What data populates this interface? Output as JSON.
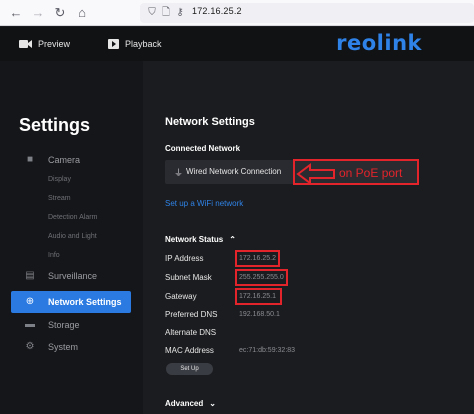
{
  "browser": {
    "url": "172.16.25.2",
    "back_icon": "arrow-left-icon",
    "forward_icon": "arrow-right-icon",
    "reload_icon": "reload-icon",
    "home_icon": "home-icon"
  },
  "header": {
    "preview_label": "Preview",
    "playback_label": "Playback",
    "logo_text": "reolink",
    "logo_color": "#2f83e8"
  },
  "sidebar": {
    "title": "Settings",
    "groups": [
      {
        "label": "Camera",
        "icon": "camera-icon"
      },
      {
        "label": "Surveillance",
        "icon": "surveillance-icon"
      },
      {
        "label": "Network Settings",
        "icon": "globe-icon",
        "active": true
      },
      {
        "label": "Storage",
        "icon": "storage-icon"
      },
      {
        "label": "System",
        "icon": "gear-icon"
      }
    ],
    "camera_subitems": [
      "Display",
      "Stream",
      "Detection Alarm",
      "Audio and Light",
      "Info"
    ],
    "active_color": "#2a7ae2"
  },
  "main": {
    "title": "Network Settings",
    "connected_network_label": "Connected Network",
    "connection_value": "Wired Network Connection",
    "wifi_link": "Set up a WiFi network",
    "network_status_label": "Network Status",
    "rows": [
      {
        "label": "IP Address",
        "value": "172.16.25.2"
      },
      {
        "label": "Subnet Mask",
        "value": "255.255.255.0"
      },
      {
        "label": "Gateway",
        "value": "172.16.25.1"
      },
      {
        "label": "Preferred DNS",
        "value": "192.168.50.1"
      },
      {
        "label": "Alternate DNS",
        "value": ""
      },
      {
        "label": "MAC Address",
        "value": "ec:71:db:59:32:83"
      }
    ],
    "setup_button": "Set Up",
    "advanced_label": "Advanced"
  },
  "annotation": {
    "text": "on PoE port",
    "color": "#e3242b"
  }
}
